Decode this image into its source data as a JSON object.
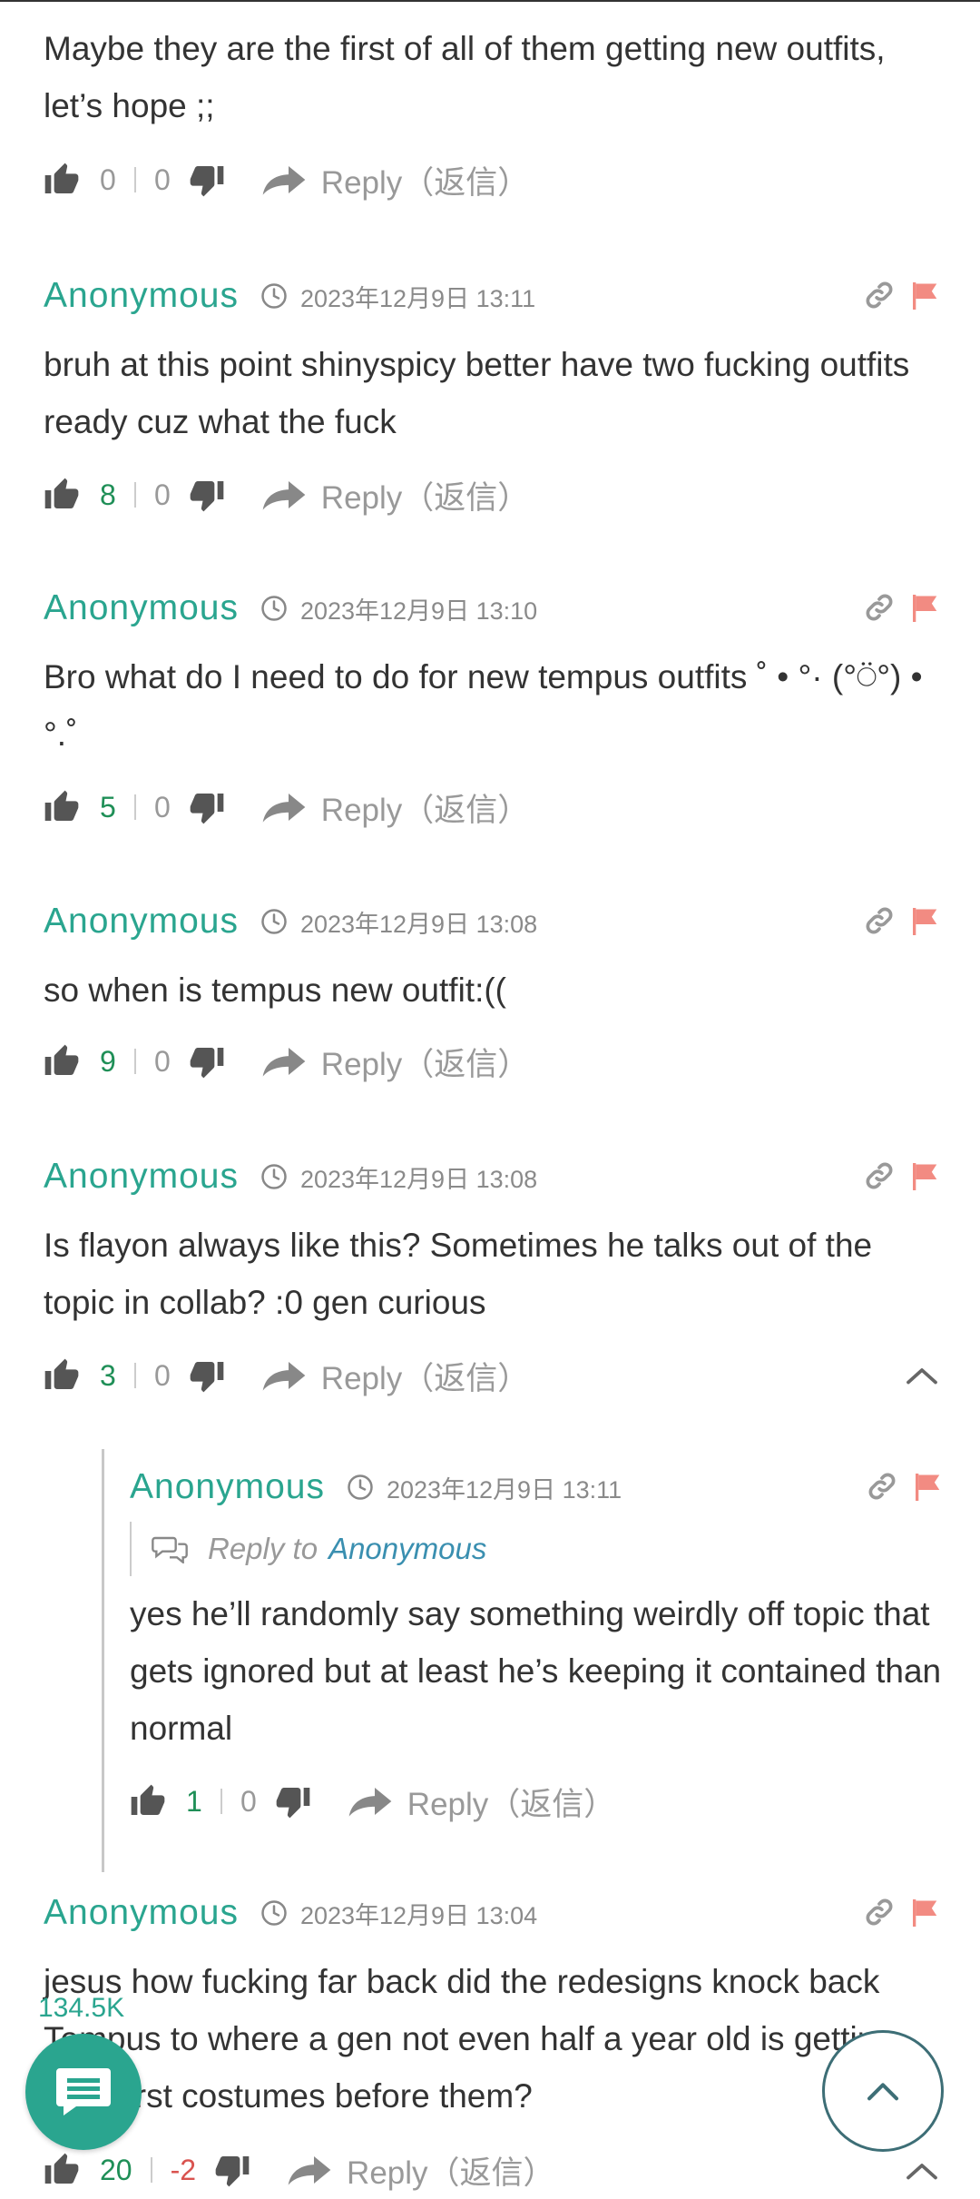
{
  "comments": [
    {
      "author": "",
      "time": "",
      "text": "Maybe they are the first of all of them getting new outfits, let’s hope ;;",
      "up": "0",
      "down": "0",
      "reply_label": "Reply（返信）"
    },
    {
      "author": "Anonymous",
      "time": "2023年12月9日 13:11",
      "text": "bruh at this point shinyspicy better have two fucking outfits ready cuz what the fuck",
      "up": "8",
      "down": "0",
      "reply_label": "Reply（返信）"
    },
    {
      "author": "Anonymous",
      "time": "2023年12月9日 13:10",
      "text": "Bro what do I need to do for new tempus outfits ˚ • °· (°⍥°) • °.˚",
      "up": "5",
      "down": "0",
      "reply_label": "Reply（返信）"
    },
    {
      "author": "Anonymous",
      "time": "2023年12月9日 13:08",
      "text": "so when is tempus new outfit:((",
      "up": "9",
      "down": "0",
      "reply_label": "Reply（返信）"
    },
    {
      "author": "Anonymous",
      "time": "2023年12月9日 13:08",
      "text": "Is flayon always like this? Sometimes he talks out of the topic in collab? :0 gen curious",
      "up": "3",
      "down": "0",
      "reply_label": "Reply（返信）"
    },
    {
      "author": "Anonymous",
      "time": "2023年12月9日 13:04",
      "text": "jesus how fucking far back did the redesigns knock back Tempus to where a gen not even half a year old is getting their first costumes before them?",
      "up": "20",
      "down": "-2",
      "reply_label": "Reply（返信）"
    }
  ],
  "reply": {
    "author": "Anonymous",
    "time": "2023年12月9日 13:11",
    "reply_to_label": "Reply to",
    "reply_to_name": "Anonymous",
    "text": "yes he’ll randomly say something weirdly off topic that gets ignored but at least he’s keeping it contained than normal",
    "up": "1",
    "down": "0",
    "reply_label": "Reply（返信）"
  },
  "comment_count": "134.5K",
  "colors": {
    "accent": "#2aa58f",
    "upvote": "#1f8f57",
    "downvote_negative": "#d9534f",
    "flag": "#f28b82",
    "reply_to_name": "#3a8fb0"
  }
}
